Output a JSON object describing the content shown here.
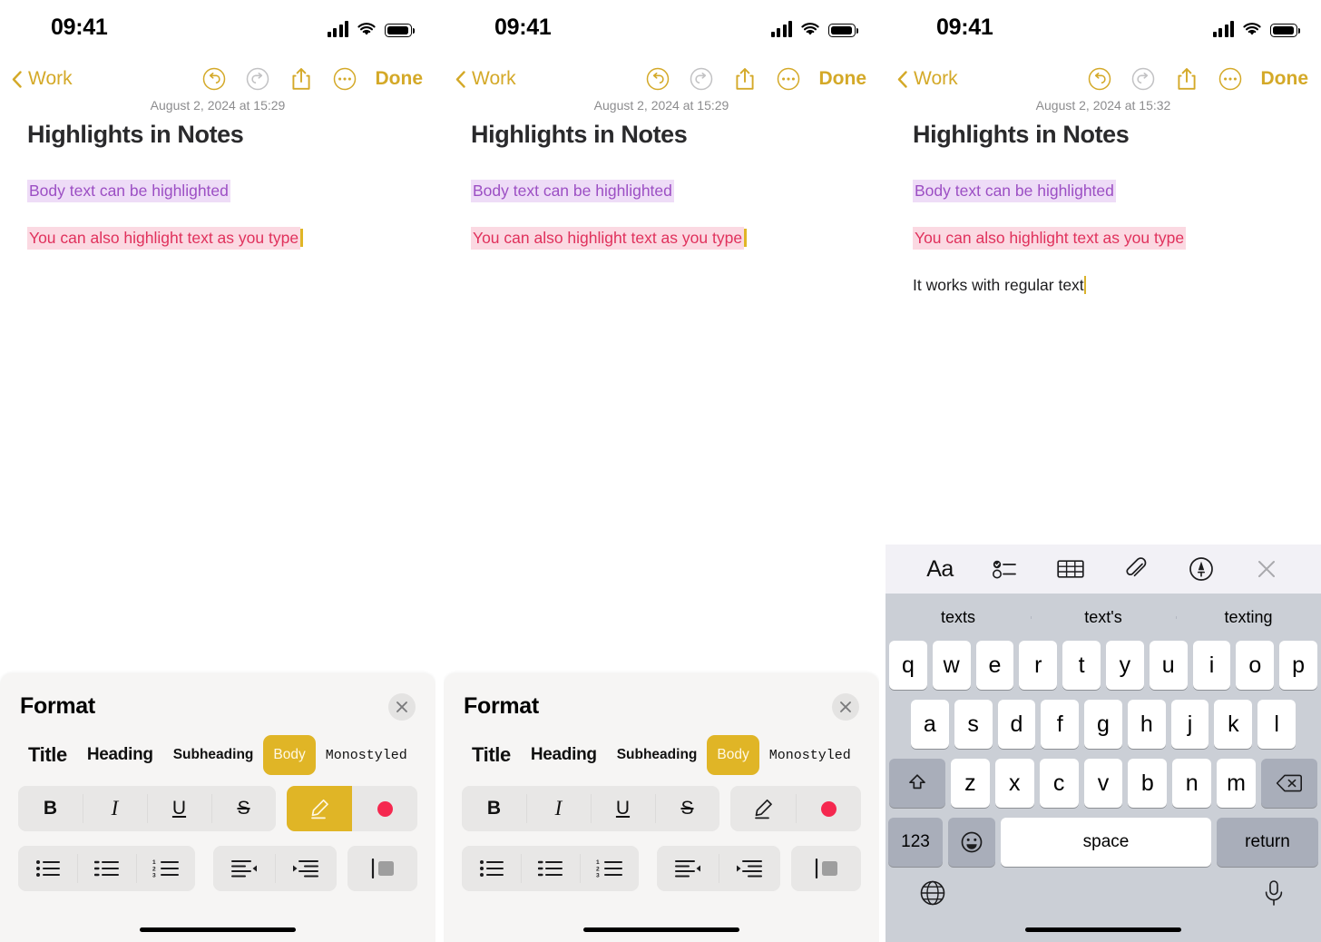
{
  "status_bar": {
    "time": "09:41",
    "cellular_icon": "cellular-bars-icon",
    "wifi_icon": "wifi-icon",
    "battery_icon": "battery-icon"
  },
  "nav": {
    "back_label": "Work",
    "done_label": "Done",
    "undo_icon": "undo-icon",
    "redo_icon": "redo-icon",
    "share_icon": "share-icon",
    "more_icon": "more-ellipsis-icon"
  },
  "panels": [
    {
      "id": "panel-1",
      "note": {
        "date": "August 2, 2024 at 15:29",
        "title": "Highlights in Notes",
        "lines": [
          {
            "text": "Body text can be highlighted",
            "highlight": "purple",
            "caret": false
          },
          {
            "text": "You can also highlight text as you type",
            "highlight": "pink",
            "caret": true
          }
        ]
      },
      "bottom": "format-sheet",
      "highlighter_active": true
    },
    {
      "id": "panel-2",
      "note": {
        "date": "August 2, 2024 at 15:29",
        "title": "Highlights in Notes",
        "lines": [
          {
            "text": "Body text can be highlighted",
            "highlight": "purple",
            "caret": false
          },
          {
            "text": "You can also highlight text as you type",
            "highlight": "pink",
            "caret": true
          }
        ]
      },
      "bottom": "format-sheet",
      "highlighter_active": false
    },
    {
      "id": "panel-3",
      "note": {
        "date": "August 2, 2024 at 15:32",
        "title": "Highlights in Notes",
        "lines": [
          {
            "text": "Body text can be highlighted",
            "highlight": "purple",
            "caret": false
          },
          {
            "text": "You can also highlight text as you type",
            "highlight": "pink",
            "caret": false
          },
          {
            "text": "It works with regular text",
            "highlight": "none",
            "caret": true
          }
        ]
      },
      "bottom": "keyboard"
    }
  ],
  "format_sheet": {
    "title": "Format",
    "close_icon": "close-x-icon",
    "styles": [
      {
        "label": "Title",
        "active": false
      },
      {
        "label": "Heading",
        "active": false
      },
      {
        "label": "Subheading",
        "active": false
      },
      {
        "label": "Body",
        "active": true
      },
      {
        "label": "Monostyled",
        "active": false
      }
    ],
    "text_buttons": [
      {
        "label": "B",
        "name": "bold-button"
      },
      {
        "label": "I",
        "name": "italic-button"
      },
      {
        "label": "U",
        "name": "underline-button"
      },
      {
        "label": "S",
        "name": "strikethrough-button"
      }
    ],
    "highlight_button": {
      "name": "highlighter-button",
      "icon": "highlighter-pen-icon"
    },
    "color_button": {
      "name": "highlight-color-button",
      "icon": "color-swatch-icon",
      "color": "#f5284f"
    },
    "list_buttons": [
      {
        "name": "bulleted-list-button",
        "icon": "bulleted-list-icon"
      },
      {
        "name": "dashed-list-button",
        "icon": "dashed-list-icon"
      },
      {
        "name": "numbered-list-button",
        "icon": "numbered-list-icon"
      }
    ],
    "indent_buttons": [
      {
        "name": "outdent-button",
        "icon": "outdent-icon"
      },
      {
        "name": "indent-button",
        "icon": "indent-icon"
      }
    ],
    "block_quote_button": {
      "name": "block-quote-button",
      "icon": "block-quote-icon"
    }
  },
  "keyboard": {
    "toolbar": [
      {
        "name": "text-format-tool",
        "label": "Aa",
        "icon": "aa-text-icon"
      },
      {
        "name": "checklist-tool",
        "icon": "checklist-icon"
      },
      {
        "name": "table-tool",
        "icon": "table-icon"
      },
      {
        "name": "attach-tool",
        "icon": "paperclip-icon"
      },
      {
        "name": "markup-tool",
        "icon": "markup-pen-icon"
      },
      {
        "name": "dismiss-keyboard-tool",
        "icon": "close-x-icon"
      }
    ],
    "suggestions": [
      "texts",
      "text's",
      "texting"
    ],
    "row1": [
      "q",
      "w",
      "e",
      "r",
      "t",
      "y",
      "u",
      "i",
      "o",
      "p"
    ],
    "row2": [
      "a",
      "s",
      "d",
      "f",
      "g",
      "h",
      "j",
      "k",
      "l"
    ],
    "row3": [
      "z",
      "x",
      "c",
      "v",
      "b",
      "n",
      "m"
    ],
    "shift_icon": "shift-arrow-icon",
    "backspace_icon": "backspace-icon",
    "numbers_label": "123",
    "emoji_icon": "emoji-smiley-icon",
    "space_label": "space",
    "return_label": "return",
    "globe_icon": "globe-icon",
    "mic_icon": "microphone-icon"
  },
  "colors": {
    "accent_yellow": "#d4a928",
    "highlight_yellow": "#e0b526",
    "purple_highlight_bg": "#eedcf7",
    "purple_text": "#9c4fc4",
    "pink_highlight_bg": "#fbd9e2",
    "pink_text": "#e0315c",
    "swatch_pink": "#f5284f"
  }
}
